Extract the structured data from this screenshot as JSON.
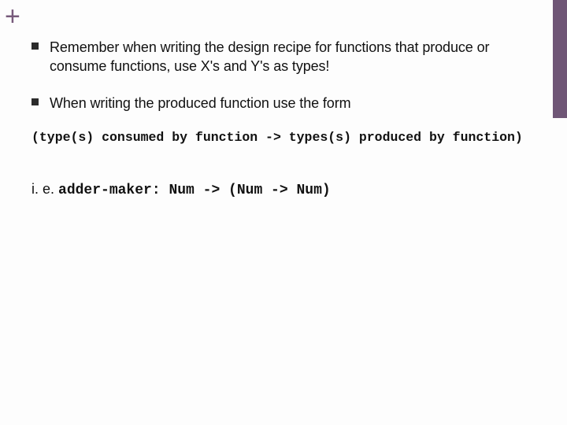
{
  "decor": {
    "plus": "+"
  },
  "bullets": [
    {
      "text": "Remember when writing the design recipe for functions that produce or consume functions, use X's and Y's as types!"
    },
    {
      "text": "When writing the produced function use the form"
    }
  ],
  "codeLine": "(type(s) consumed by function -> types(s) produced by function)",
  "example": {
    "prefix": "i. e. ",
    "code": "adder-maker: Num -> (Num -> Num)"
  }
}
